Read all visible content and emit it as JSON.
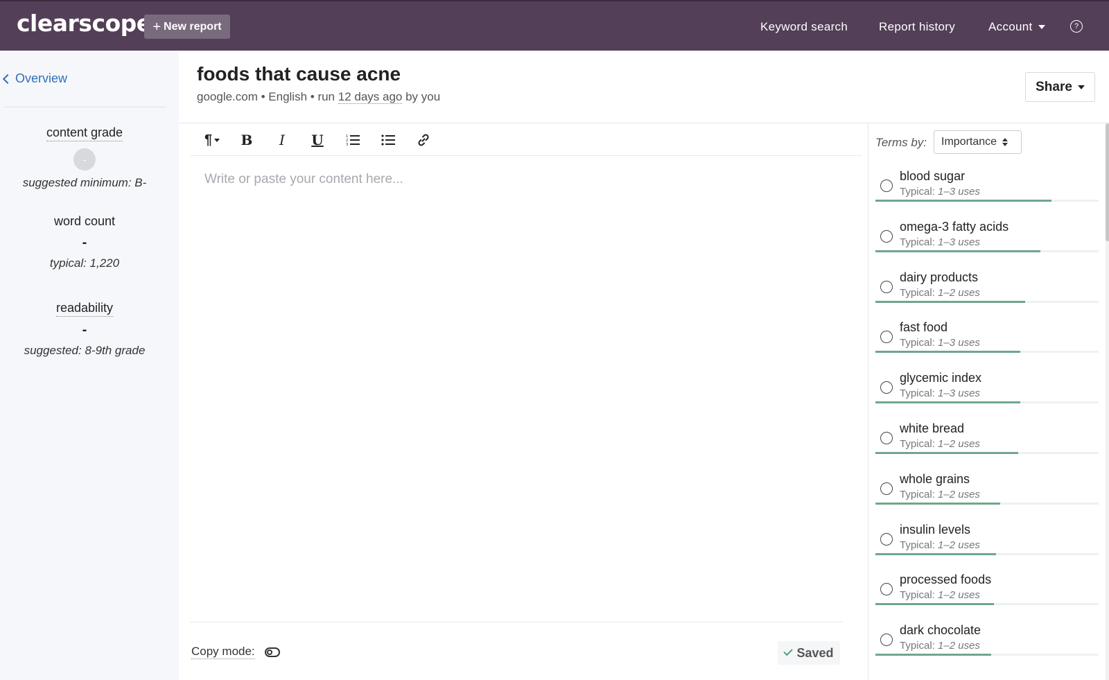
{
  "topbar": {
    "logo": "clearscope",
    "new_report": "New report",
    "nav_keyword": "Keyword search",
    "nav_history": "Report history",
    "nav_account": "Account",
    "help": "?"
  },
  "sidebar": {
    "overview": "Overview",
    "content_grade_label": "content grade",
    "content_grade_value": "-",
    "content_grade_hint": "suggested minimum: B-",
    "word_count_label": "word count",
    "word_count_value": "-",
    "word_count_hint": "typical: 1,220",
    "readability_label": "readability",
    "readability_value": "-",
    "readability_hint": "suggested: 8-9th grade"
  },
  "report": {
    "title": "foods that cause acne",
    "meta_prefix": "google.com • English • run ",
    "meta_ago": "12 days ago",
    "meta_suffix": " by you",
    "share": "Share"
  },
  "editor": {
    "placeholder": "Write or paste your content here...",
    "copy_mode": "Copy mode:",
    "saved": "Saved"
  },
  "terms_panel": {
    "terms_by": "Terms by:",
    "sort_selected": "Importance",
    "typical_prefix": "Typical: ",
    "items": [
      {
        "name": "blood sugar",
        "uses": "1–3 uses",
        "importance": 0.79
      },
      {
        "name": "omega-3 fatty acids",
        "uses": "1–3 uses",
        "importance": 0.74
      },
      {
        "name": "dairy products",
        "uses": "1–2 uses",
        "importance": 0.67
      },
      {
        "name": "fast food",
        "uses": "1–3 uses",
        "importance": 0.65
      },
      {
        "name": "glycemic index",
        "uses": "1–3 uses",
        "importance": 0.65
      },
      {
        "name": "white bread",
        "uses": "1–2 uses",
        "importance": 0.64
      },
      {
        "name": "whole grains",
        "uses": "1–2 uses",
        "importance": 0.56
      },
      {
        "name": "insulin levels",
        "uses": "1–2 uses",
        "importance": 0.54
      },
      {
        "name": "processed foods",
        "uses": "1–2 uses",
        "importance": 0.53
      },
      {
        "name": "dark chocolate",
        "uses": "1–2 uses",
        "importance": 0.52
      }
    ]
  },
  "colors": {
    "topbar": "#533f57",
    "accent_link": "#2f70b8",
    "importance_bar": "#6fa68c"
  }
}
